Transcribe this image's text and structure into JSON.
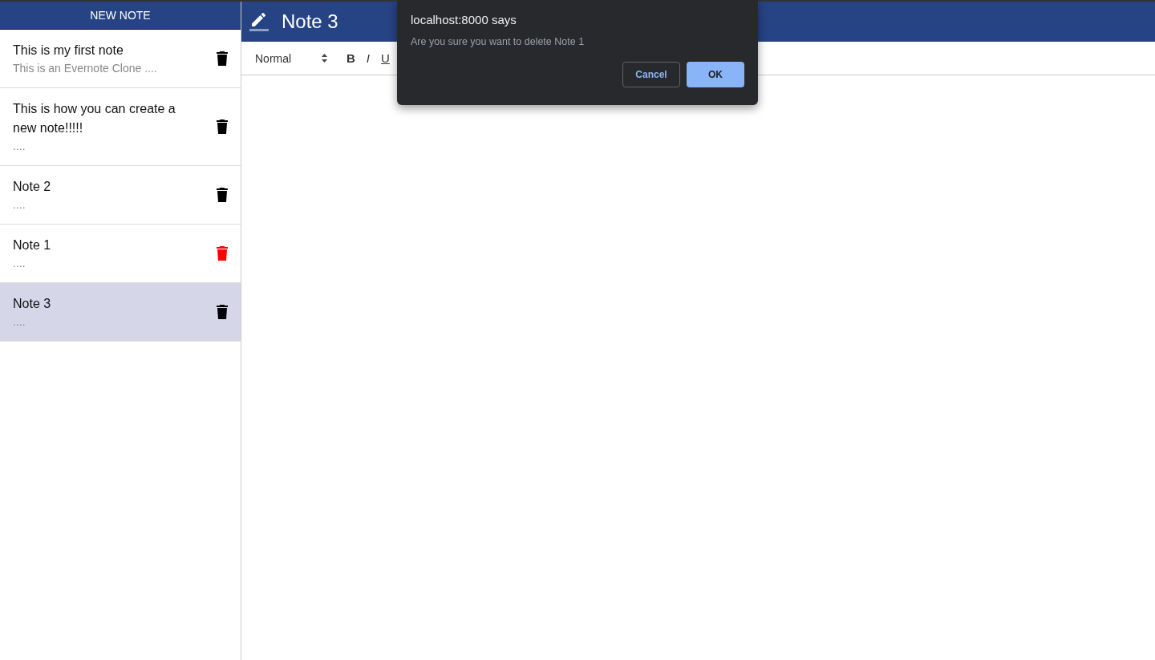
{
  "sidebar": {
    "new_note_button": "NEW NOTE",
    "notes": [
      {
        "title": "This is my first note",
        "preview": "This is an Evernote Clone ....",
        "selected": false,
        "delete_hover": false
      },
      {
        "title": "This is how you can create a new note!!!!!",
        "preview": "....",
        "selected": false,
        "delete_hover": false
      },
      {
        "title": "Note 2",
        "preview": "....",
        "selected": false,
        "delete_hover": false
      },
      {
        "title": "Note 1",
        "preview": "....",
        "selected": false,
        "delete_hover": true
      },
      {
        "title": "Note 3",
        "preview": "....",
        "selected": true,
        "delete_hover": false
      }
    ]
  },
  "editor": {
    "title": "Note 3",
    "toolbar": {
      "heading_select": "Normal",
      "buttons": [
        {
          "kind": "bold",
          "label": "B"
        },
        {
          "kind": "italic",
          "label": "I"
        },
        {
          "kind": "underline",
          "label": "U"
        }
      ]
    }
  },
  "dialog": {
    "title": "localhost:8000 says",
    "message": "Are you sure you want to delete Note 1",
    "buttons": [
      {
        "kind": "cancel",
        "label": "Cancel"
      },
      {
        "kind": "ok",
        "label": "OK"
      }
    ]
  }
}
